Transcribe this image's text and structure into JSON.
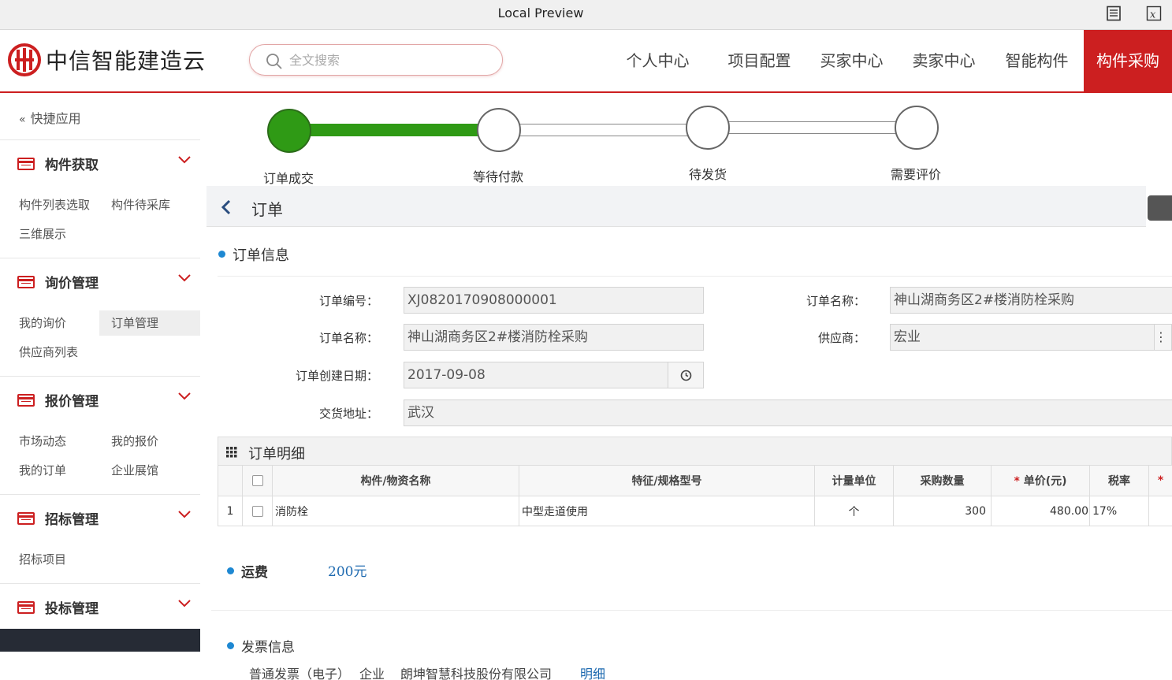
{
  "window": {
    "title": "Local Preview"
  },
  "header": {
    "logo_text": "中信智能建造云",
    "search_placeholder": "全文搜索",
    "nav": [
      "个人中心",
      "项目配置",
      "买家中心",
      "卖家中心",
      "智能构件",
      "构件采购"
    ],
    "active_nav": "构件采购",
    "accent_color": "#cc1f20"
  },
  "sidebar": {
    "quick_label": "快捷应用",
    "sections": [
      {
        "title": "构件获取",
        "items": [
          "构件列表选取",
          "构件待采库",
          "三维展示"
        ]
      },
      {
        "title": "询价管理",
        "items": [
          "我的询价",
          "订单管理",
          "供应商列表"
        ],
        "active_item": "订单管理"
      },
      {
        "title": "报价管理",
        "items": [
          "市场动态",
          "我的报价",
          "我的订单",
          "企业展馆"
        ]
      },
      {
        "title": "招标管理",
        "items": [
          "招标项目"
        ]
      },
      {
        "title": "投标管理",
        "items": []
      }
    ]
  },
  "steps": {
    "labels": [
      "订单成交",
      "等待付款",
      "待发货",
      "需要评价"
    ],
    "completed_count": 1,
    "done_color": "#2f9a15"
  },
  "order": {
    "page_title": "订单",
    "info_title": "订单信息",
    "fields": {
      "order_no_label": "订单编号：",
      "order_no": "XJ0820170908000001",
      "order_name_label": "订单名称：",
      "order_name": "神山湖商务区2#楼消防栓采购",
      "order_name_right_label": "订单名称：",
      "order_name_right": "神山湖商务区2#楼消防栓采购",
      "supplier_label": "供应商：",
      "supplier": "宏业",
      "date_label": "订单创建日期：",
      "date": "2017-09-08",
      "address_label": "交货地址：",
      "address": "武汉"
    },
    "detail": {
      "title": "订单明细",
      "columns": [
        "构件/物资名称",
        "特征/规格型号",
        "计量单位",
        "采购数量",
        "单价(元)",
        "税率"
      ],
      "rows": [
        {
          "no": "1",
          "name": "消防栓",
          "spec": "中型走道使用",
          "unit": "个",
          "qty": "300",
          "price": "480.00",
          "tax": "17%"
        }
      ]
    },
    "freight": {
      "label": "运费",
      "value": "200元"
    },
    "invoice": {
      "title": "发票信息",
      "type": "普通发票（电子）",
      "kind": "企业",
      "company": "朗坤智慧科技股份有限公司",
      "link": "明细"
    }
  }
}
